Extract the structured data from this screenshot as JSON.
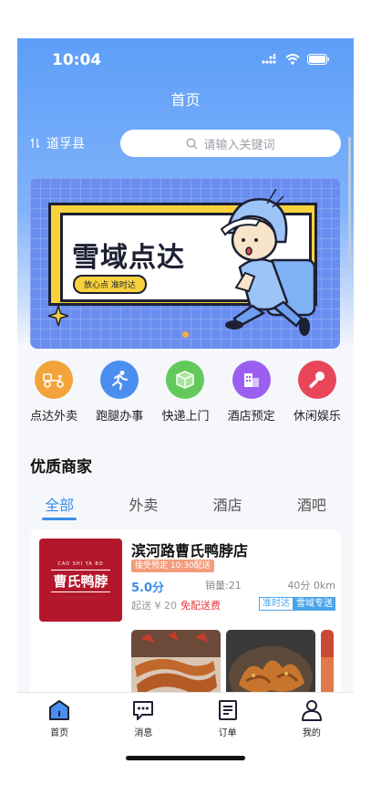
{
  "status_bar": {
    "time": "10:04"
  },
  "header": {
    "title": "首页"
  },
  "location": {
    "city": "道孚县"
  },
  "search": {
    "placeholder": "请输入关键词"
  },
  "banner": {
    "title": "雪域点达",
    "subtitle": "放心点 准时达"
  },
  "categories": [
    {
      "label": "点达外卖",
      "icon": "scooter-icon",
      "color": "#f2a33a"
    },
    {
      "label": "跑腿办事",
      "icon": "runner-icon",
      "color": "#4a8ff0"
    },
    {
      "label": "快递上门",
      "icon": "package-icon",
      "color": "#63c95b"
    },
    {
      "label": "酒店预定",
      "icon": "hotel-icon",
      "color": "#9a5ff0"
    },
    {
      "label": "休闲娱乐",
      "icon": "microphone-icon",
      "color": "#e8455a"
    }
  ],
  "section": {
    "title": "优质商家"
  },
  "tabs": [
    {
      "label": "全部",
      "active": true
    },
    {
      "label": "外卖",
      "active": false
    },
    {
      "label": "酒店",
      "active": false
    },
    {
      "label": "酒吧",
      "active": false
    }
  ],
  "store": {
    "name": "滨河路曹氏鸭脖店",
    "logo_text": "曹氏鸭脖",
    "logo_pinyin": "CAO SHI YA BO",
    "tag": "接受预定 10:30配送",
    "rating": "5.0分",
    "sales": "销量:21",
    "eta": "40分 0km",
    "min_order": "起送 ¥ 20",
    "free_delivery": "免配送费",
    "badges": [
      "准时达",
      "雪域专送"
    ]
  },
  "tabbar": [
    {
      "label": "首页",
      "icon": "home-icon"
    },
    {
      "label": "消息",
      "icon": "message-icon"
    },
    {
      "label": "订单",
      "icon": "order-icon"
    },
    {
      "label": "我的",
      "icon": "profile-icon"
    }
  ],
  "colors": {
    "primary": "#3a8ee6",
    "header_blue": "#5d9ef8",
    "banner_blue": "#6a8ef0",
    "tag_orange": "#f39b7b",
    "price_red": "#e4393c"
  }
}
